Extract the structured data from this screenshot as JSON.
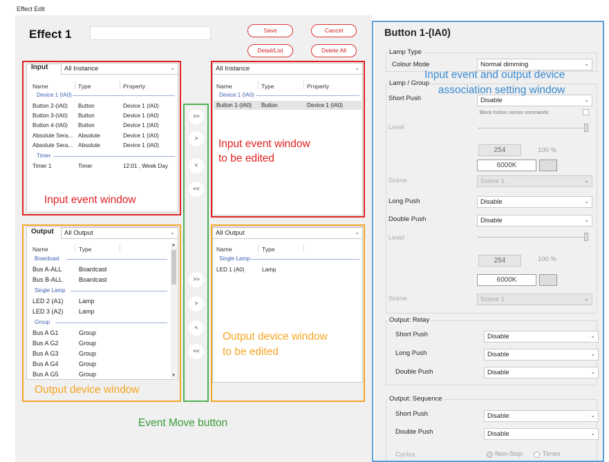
{
  "window_title": "Effect Edit",
  "effect_name": "Effect 1",
  "buttons": {
    "save": "Save",
    "cancel": "Cancel",
    "detail_list": "Detail/List",
    "delete_all": "Delete All"
  },
  "input_panel": {
    "label": "Input",
    "filter": "All Instance",
    "columns": [
      "Name",
      "Type",
      "Property"
    ],
    "group1": "Device 1 (IA0)",
    "rows": [
      [
        "Button 2-(IA0)",
        "Button",
        "Device 1 (IA0)"
      ],
      [
        "Button 3-(IA0)",
        "Button",
        "Device 1 (IA0)"
      ],
      [
        "Button 4-(IA0)",
        "Button",
        "Device 1 (IA0)"
      ],
      [
        "Absolute Sera...",
        "Absolute",
        "Device 1 (IA0)"
      ],
      [
        "Absolute Sera...",
        "Absolute",
        "Device 1 (IA0)"
      ]
    ],
    "group2": "Timer",
    "timer_row": [
      "Timer 1",
      "Timer",
      "12:01 , Week Day"
    ]
  },
  "input_edit_panel": {
    "filter": "All Instance",
    "columns": [
      "Name",
      "Type",
      "Property"
    ],
    "group": "Device 1 (IA0)",
    "row": [
      "Button 1-(IA0)",
      "Button",
      "Device 1 (IA0)"
    ]
  },
  "output_panel": {
    "label": "Output",
    "filter": "All Output",
    "columns": [
      "Name",
      "Type"
    ],
    "groups": [
      {
        "name": "Boardcast",
        "rows": [
          [
            "Bus A-ALL",
            "Boardcast"
          ],
          [
            "Bus B-ALL",
            "Boardcast"
          ]
        ]
      },
      {
        "name": "Single Lamp",
        "rows": [
          [
            "LED 2 (A1)",
            "Lamp"
          ],
          [
            "LED 3 (A2)",
            "Lamp"
          ]
        ]
      },
      {
        "name": "Group",
        "rows": [
          [
            "Bus A G1",
            "Group"
          ],
          [
            "Bus A G2",
            "Group"
          ],
          [
            "Bus A G3",
            "Group"
          ],
          [
            "Bus A G4",
            "Group"
          ],
          [
            "Bus A G5",
            "Group"
          ]
        ]
      }
    ]
  },
  "output_edit_panel": {
    "filter": "All Output",
    "columns": [
      "Name",
      "Type"
    ],
    "group": "Single Lamp",
    "row": [
      "LED 1 (A0)",
      "Lamp"
    ]
  },
  "move_buttons": {
    "all_right": ">>",
    "right": ">",
    "left": "<",
    "all_left": "<<"
  },
  "annotations": {
    "input_window": "Input event window",
    "input_edit": "Input event window\nto be edited",
    "output_window": "Output device window",
    "output_edit": "Output device window\nto be edited",
    "move": "Event Move button",
    "assoc": "Input event and output device\nassociation setting window"
  },
  "right_panel": {
    "title": "Button 1-(IA0)",
    "lamp_type": "Lamp Type",
    "colour_mode_label": "Colour Mode",
    "colour_mode_value": "Normal dimming",
    "lamp_group": "Lamp / Group",
    "short_push_label": "Short Push",
    "short_push_value": "Disable",
    "block_motion": "Block motion sensor commands",
    "level_label": "Level",
    "level_value": "254",
    "percent": "100 %",
    "kelvin": "6000K",
    "scene_label": "Scene",
    "scene_value": "Scene 1",
    "long_push_label": "Long Push",
    "long_push_value": "Disable",
    "double_push_label": "Double Push",
    "double_push_value": "Disable",
    "level2_label": "Level",
    "level2_value": "254",
    "percent2": "100 %",
    "kelvin2": "6000K",
    "scene2_label": "Scene",
    "scene2_value": "Scene 1",
    "relay_title": "Output: Relay",
    "relay_short": "Short Push",
    "relay_short_v": "Disable",
    "relay_long": "Long Push",
    "relay_long_v": "Disable",
    "relay_double": "Double Push",
    "relay_double_v": "Disable",
    "seq_title": "Output: Sequence",
    "seq_short": "Short Push",
    "seq_short_v": "Disable",
    "seq_double": "Double Push",
    "seq_double_v": "Disable",
    "cycles": "Cycles",
    "nonstop": "Non-Stop",
    "times": "Times"
  },
  "colors": {
    "red": "#e02020",
    "orange": "#f5a623",
    "green": "#4caf50",
    "blue": "#5aa0d8"
  }
}
